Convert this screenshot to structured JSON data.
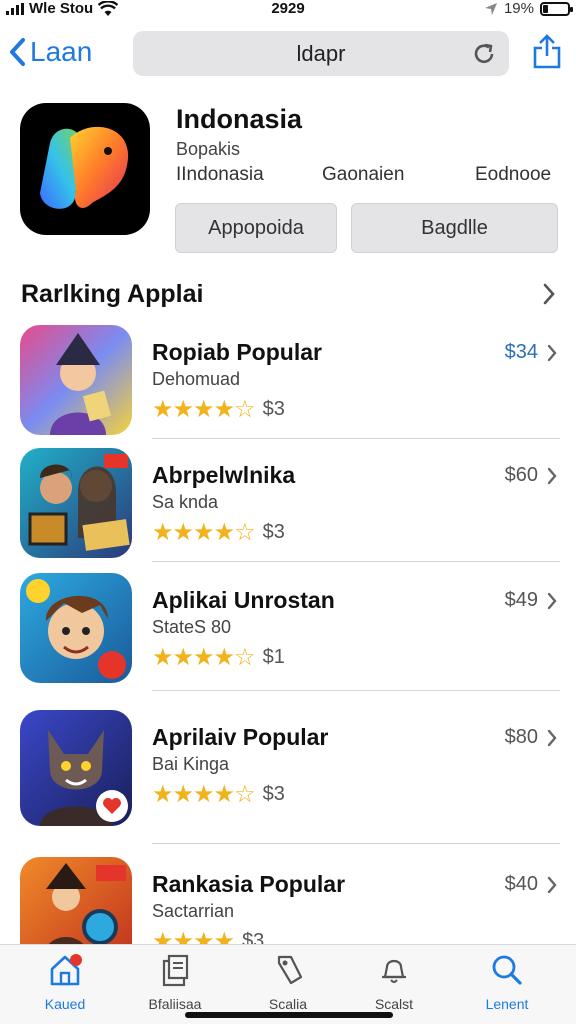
{
  "status": {
    "carrier": "Wle Stou",
    "time": "2929",
    "battery": "19%",
    "battery_level": 0.19
  },
  "nav": {
    "back_label": "Laan",
    "url": "ldapr"
  },
  "app": {
    "title": "Indonasia",
    "subtitle": "Bopakis",
    "meta": [
      "IIndonasia",
      "Gaonaien",
      "Eodnooe"
    ],
    "buttons": [
      "Appopoida",
      "Bagdlle"
    ]
  },
  "section": {
    "title": "Rarlking Applai"
  },
  "items": [
    {
      "name": "Ropiab Popular",
      "sub": "Dehomuad",
      "stars": "★★★★☆",
      "rating": "$3",
      "price": "$34",
      "price_color": "#2b6fb5"
    },
    {
      "name": "Abrpelwlnika",
      "sub": "Sa knda",
      "stars": "★★★★☆",
      "rating": "$3",
      "price": "$60",
      "price_color": "#555555"
    },
    {
      "name": "Aplikai Unrostan",
      "sub": "StateS 80",
      "stars": "★★★★☆",
      "rating": "$1",
      "price": "$49",
      "price_color": "#555555"
    },
    {
      "name": "Aprilaiv Popular",
      "sub": "Bai Kinga",
      "stars": "★★★★☆",
      "rating": "$3",
      "price": "$80",
      "price_color": "#555555"
    },
    {
      "name": "Rankasia Popular",
      "sub": "Sactarrian",
      "stars": "★★★★",
      "rating": "$3",
      "price": "$40",
      "price_color": "#555555"
    }
  ],
  "tabs": [
    {
      "label": "Kaued",
      "icon": "home-icon"
    },
    {
      "label": "Bfaliisaa",
      "icon": "document-icon"
    },
    {
      "label": "Scalia",
      "icon": "tag-icon"
    },
    {
      "label": "Scalst",
      "icon": "bell-icon"
    },
    {
      "label": "Lenent",
      "icon": "search-icon"
    }
  ],
  "colors": {
    "accent": "#1f7ae0",
    "star": "#f2b21b",
    "badge": "#e5352b"
  }
}
